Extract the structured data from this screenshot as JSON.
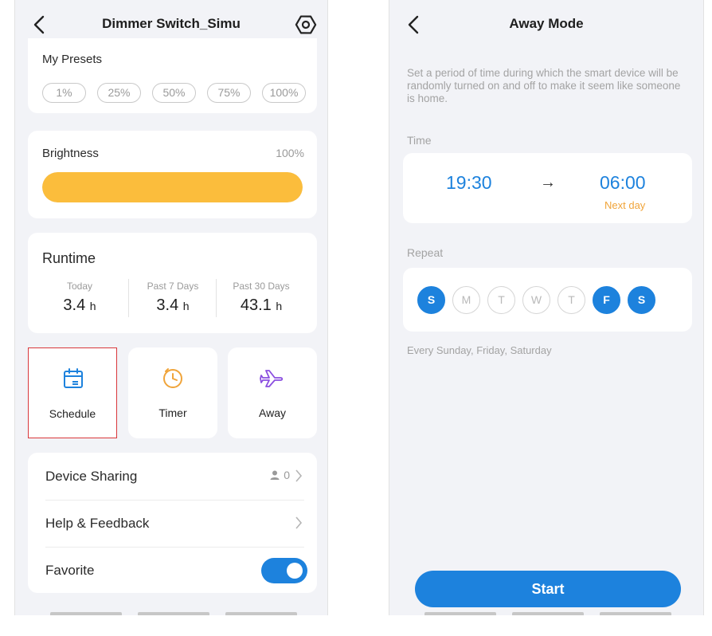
{
  "left_screen": {
    "title": "Dimmer Switch_Simu",
    "presets": {
      "label": "My Presets",
      "items": [
        "1%",
        "25%",
        "50%",
        "75%",
        "100%"
      ]
    },
    "brightness": {
      "label": "Brightness",
      "value_text": "100%",
      "level": 1.0,
      "fill_color": "#fbbd3c"
    },
    "runtime": {
      "label": "Runtime",
      "stats": [
        {
          "label": "Today",
          "value": "3.4",
          "unit": "h"
        },
        {
          "label": "Past 7 Days",
          "value": "3.4",
          "unit": "h"
        },
        {
          "label": "Past 30 Days",
          "value": "43.1",
          "unit": "h"
        }
      ]
    },
    "tiles": [
      {
        "label": "Schedule",
        "icon": "calendar-icon"
      },
      {
        "label": "Timer",
        "icon": "clock-icon"
      },
      {
        "label": "Away",
        "icon": "airplane-icon"
      }
    ],
    "menu": {
      "device_sharing": {
        "label": "Device Sharing",
        "count": "0"
      },
      "help": {
        "label": "Help & Feedback"
      },
      "favorite": {
        "label": "Favorite",
        "enabled": true
      }
    }
  },
  "right_screen": {
    "title": "Away Mode",
    "description": "Set a period of time during which the smart device will be randomly turned on and off to make it seem like someone is home.",
    "time": {
      "label": "Time",
      "start": "19:30",
      "arrow": "→",
      "end": "06:00",
      "end_note": "Next day"
    },
    "repeat": {
      "label": "Repeat",
      "days": [
        {
          "letter": "S",
          "selected": true
        },
        {
          "letter": "M",
          "selected": false
        },
        {
          "letter": "T",
          "selected": false
        },
        {
          "letter": "W",
          "selected": false
        },
        {
          "letter": "T",
          "selected": false
        },
        {
          "letter": "F",
          "selected": true
        },
        {
          "letter": "S",
          "selected": true
        }
      ],
      "summary": "Every Sunday, Friday, Saturday"
    },
    "start_button": "Start"
  },
  "colors": {
    "accent": "#1d82dd",
    "highlight_border": "#d9373b",
    "timer_orange": "#f0a43a",
    "away_purple": "#8b4fe0"
  }
}
